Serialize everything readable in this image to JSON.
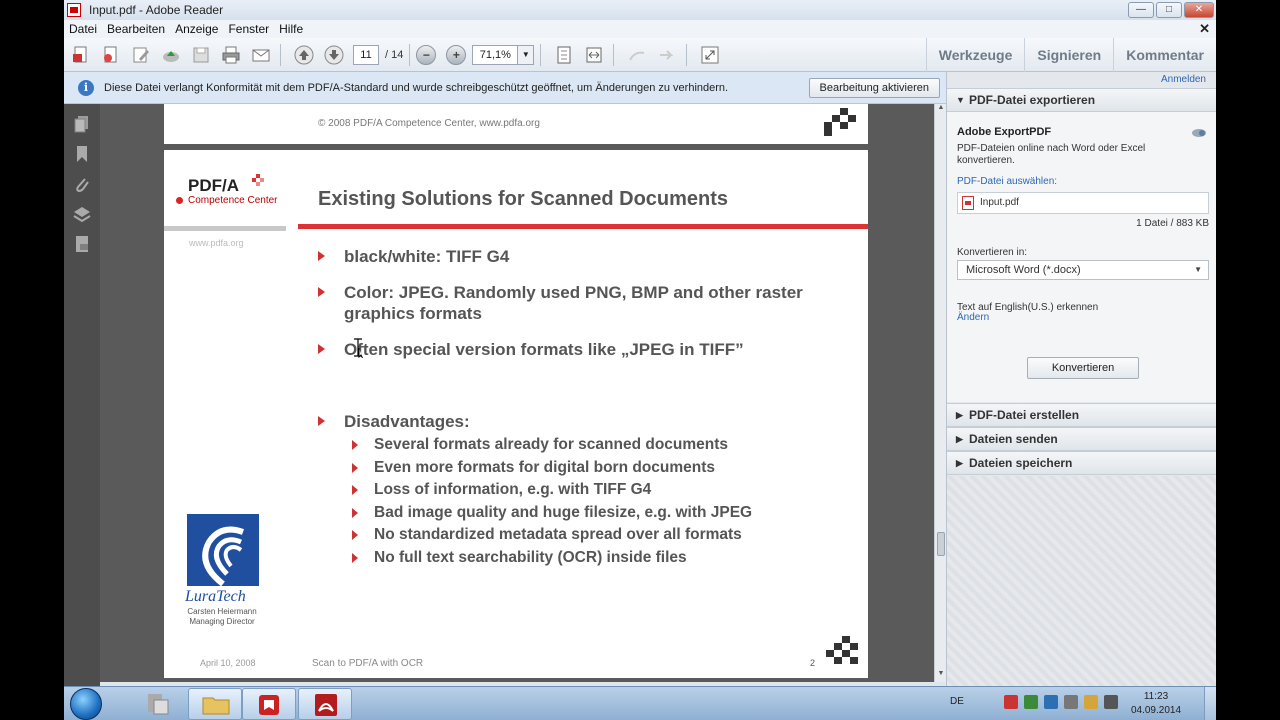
{
  "window": {
    "title": "Input.pdf - Adobe Reader",
    "minimize": "—",
    "maximize": "□",
    "close": "✕",
    "doc_close": "✕"
  },
  "menu": [
    "Datei",
    "Bearbeiten",
    "Anzeige",
    "Fenster",
    "Hilfe"
  ],
  "toolbar": {
    "page_current": "11",
    "page_total": "/ 14",
    "zoom_out": "−",
    "zoom_in": "+",
    "zoom": "71,1%",
    "tools": "Werkzeuge",
    "sign": "Signieren",
    "comment": "Kommentar"
  },
  "infobar": {
    "icon": "i",
    "message": "Diese Datei verlangt Konformität mit dem PDF/A-Standard und wurde schreibgeschützt geöffnet, um Änderungen zu verhindern.",
    "button": "Bearbeitung aktivieren"
  },
  "document": {
    "prev_page_footer": "© 2008  PDF/A Competence Center, www.pdfa.org",
    "logo_text": "PDF/A",
    "logo_sub": "Competence Center",
    "left_url": "www.pdfa.org",
    "luratech": "LuraTech",
    "speaker_name": "Carsten Heiermann",
    "speaker_role": "Managing Director",
    "date": "April 10, 2008",
    "title": "Existing Solutions for Scanned Documents",
    "bullets": [
      "black/white: TIFF G4",
      "Color: JPEG. Randomly used PNG, BMP and other raster graphics formats",
      "Often special version formats like „JPEG in TIFF”"
    ],
    "disadvantages_label": "Disadvantages:",
    "sub_bullets": [
      "Several formats already for scanned documents",
      "Even more formats for digital born documents",
      "Loss of information, e.g. with TIFF G4",
      "Bad image quality and huge filesize, e.g. with JPEG",
      "No standardized metadata spread over all formats",
      "No full text searchability (OCR) inside files"
    ],
    "footer": "Scan to PDF/A with OCR",
    "page_number": "2"
  },
  "right_panel": {
    "login": "Anmelden",
    "export_title": "PDF-Datei exportieren",
    "service": "Adobe ExportPDF",
    "service_desc": "PDF-Dateien online nach Word oder Excel konvertieren.",
    "select_label": "PDF-Datei auswählen:",
    "file_name": "Input.pdf",
    "file_info": "1 Datei / 883 KB",
    "convert_to_label": "Konvertieren in:",
    "convert_to": "Microsoft Word (*.docx)",
    "ocr_text": "Text auf English(U.S.) erkennen",
    "change": "Ändern",
    "convert_button": "Konvertieren",
    "sections": [
      "PDF-Datei erstellen",
      "Dateien senden",
      "Dateien speichern"
    ]
  },
  "taskbar": {
    "language": "DE",
    "time": "11:23",
    "date": "04.09.2014"
  }
}
